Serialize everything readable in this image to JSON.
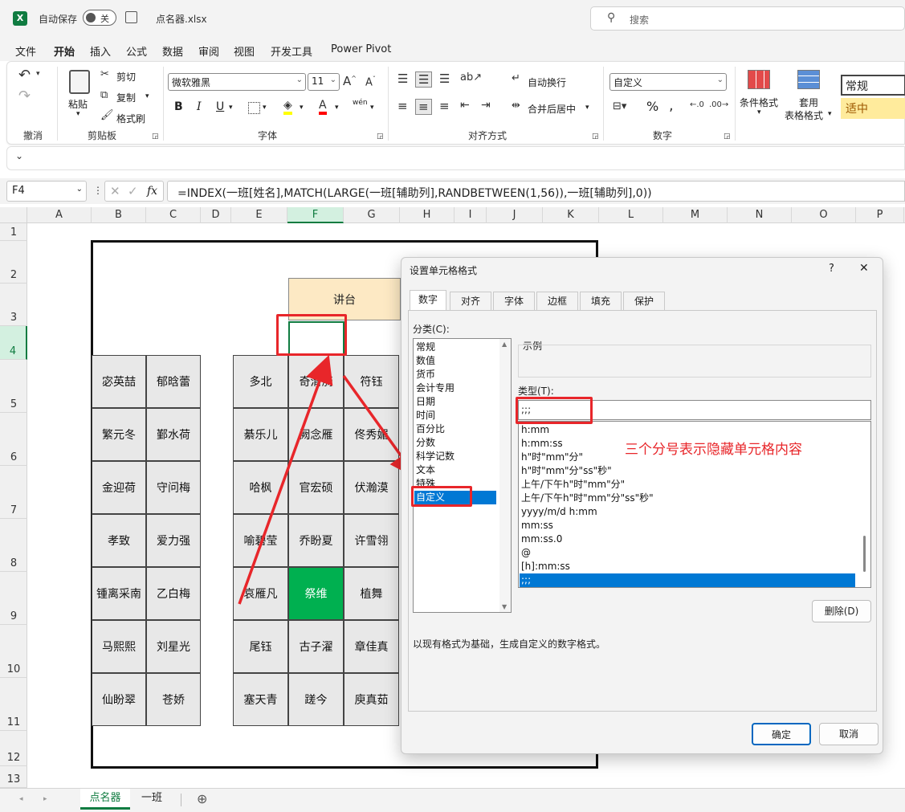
{
  "titlebar": {
    "autosave_label": "自动保存",
    "toggle_state": "关",
    "filename": "点名器.xlsx",
    "search_placeholder": "搜索"
  },
  "menu": [
    "文件",
    "开始",
    "插入",
    "公式",
    "数据",
    "审阅",
    "视图",
    "开发工具",
    "Power Pivot"
  ],
  "ribbon": {
    "groups": [
      "撤消",
      "剪贴板",
      "字体",
      "对齐方式",
      "数字"
    ],
    "paste": "粘贴",
    "cut": "剪切",
    "copy": "复制",
    "format_painter": "格式刷",
    "font_name": "微软雅黑",
    "font_size": "11",
    "bold": "B",
    "italic": "I",
    "underline": "U",
    "wen": "wén",
    "wrap_text": "自动换行",
    "merge_center": "合并后居中",
    "number_format": "自定义",
    "percent": "%",
    "cond_format": "条件格式",
    "table_format_1": "套用",
    "table_format_2": "表格格式",
    "style_normal": "常规",
    "style_neutral": "适中"
  },
  "formula_bar": {
    "name_box": "F4",
    "fx": "fx",
    "formula": "=INDEX(一班[姓名],MATCH(LARGE(一班[辅助列],RANDBETWEEN(1,56)),一班[辅助列],0))"
  },
  "columns": [
    "A",
    "B",
    "C",
    "D",
    "E",
    "F",
    "G",
    "H",
    "I",
    "J",
    "K",
    "L",
    "M",
    "N",
    "O",
    "P"
  ],
  "rows": [
    "1",
    "2",
    "3",
    "4",
    "5",
    "6",
    "7",
    "8",
    "9",
    "10",
    "11",
    "12",
    "13"
  ],
  "seats": {
    "podium": "讲台",
    "left": [
      [
        "宓英喆",
        "郁晗蕾"
      ],
      [
        "繁元冬",
        "鄞水荷"
      ],
      [
        "金迎荷",
        "守问梅"
      ],
      [
        "孝致",
        "爱力强"
      ],
      [
        "锺离采南",
        "乙白梅"
      ],
      [
        "马熙熙",
        "刘星光"
      ],
      [
        "仙盼翠",
        "苍娇"
      ]
    ],
    "right": [
      [
        "多北",
        "奇清漪",
        "符钰"
      ],
      [
        "綦乐儿",
        "阙念雁",
        "佟秀媚"
      ],
      [
        "哈枫",
        "官宏硕",
        "伏瀚漠"
      ],
      [
        "喻碧莹",
        "乔盼夏",
        "许雪翎"
      ],
      [
        "哀雁凡",
        "祭维",
        "植舞"
      ],
      [
        "尾钰",
        "古子濯",
        "章佳真"
      ],
      [
        "塞天青",
        "蹉今",
        "庾真茹"
      ]
    ]
  },
  "sheet_tabs": [
    "点名器",
    "一班"
  ],
  "dialog": {
    "title": "设置单元格格式",
    "help": "?",
    "close": "✕",
    "tabs": [
      "数字",
      "对齐",
      "字体",
      "边框",
      "填充",
      "保护"
    ],
    "category_label": "分类(C):",
    "categories": [
      "常规",
      "数值",
      "货币",
      "会计专用",
      "日期",
      "时间",
      "百分比",
      "分数",
      "科学记数",
      "文本",
      "特殊",
      "自定义"
    ],
    "sample_label": "示例",
    "type_label": "类型(T):",
    "type_value": ";;;",
    "formats": [
      "h:mm",
      "h:mm:ss",
      "h\"时\"mm\"分\"",
      "h\"时\"mm\"分\"ss\"秒\"",
      "上午/下午h\"时\"mm\"分\"",
      "上午/下午h\"时\"mm\"分\"ss\"秒\"",
      "yyyy/m/d h:mm",
      "mm:ss",
      "mm:ss.0",
      "@",
      "[h]:mm:ss",
      ";;;"
    ],
    "delete": "删除(D)",
    "hint": "以现有格式为基础，生成自定义的数字格式。",
    "ok": "确定",
    "cancel": "取消"
  },
  "annotation": "三个分号表示隐藏单元格内容",
  "colors": {
    "accent": "#107c41",
    "selected_fill": "#00b050",
    "podium_fill": "#fde9c4",
    "annotation_red": "#e8262a",
    "list_select": "#0078d4"
  }
}
